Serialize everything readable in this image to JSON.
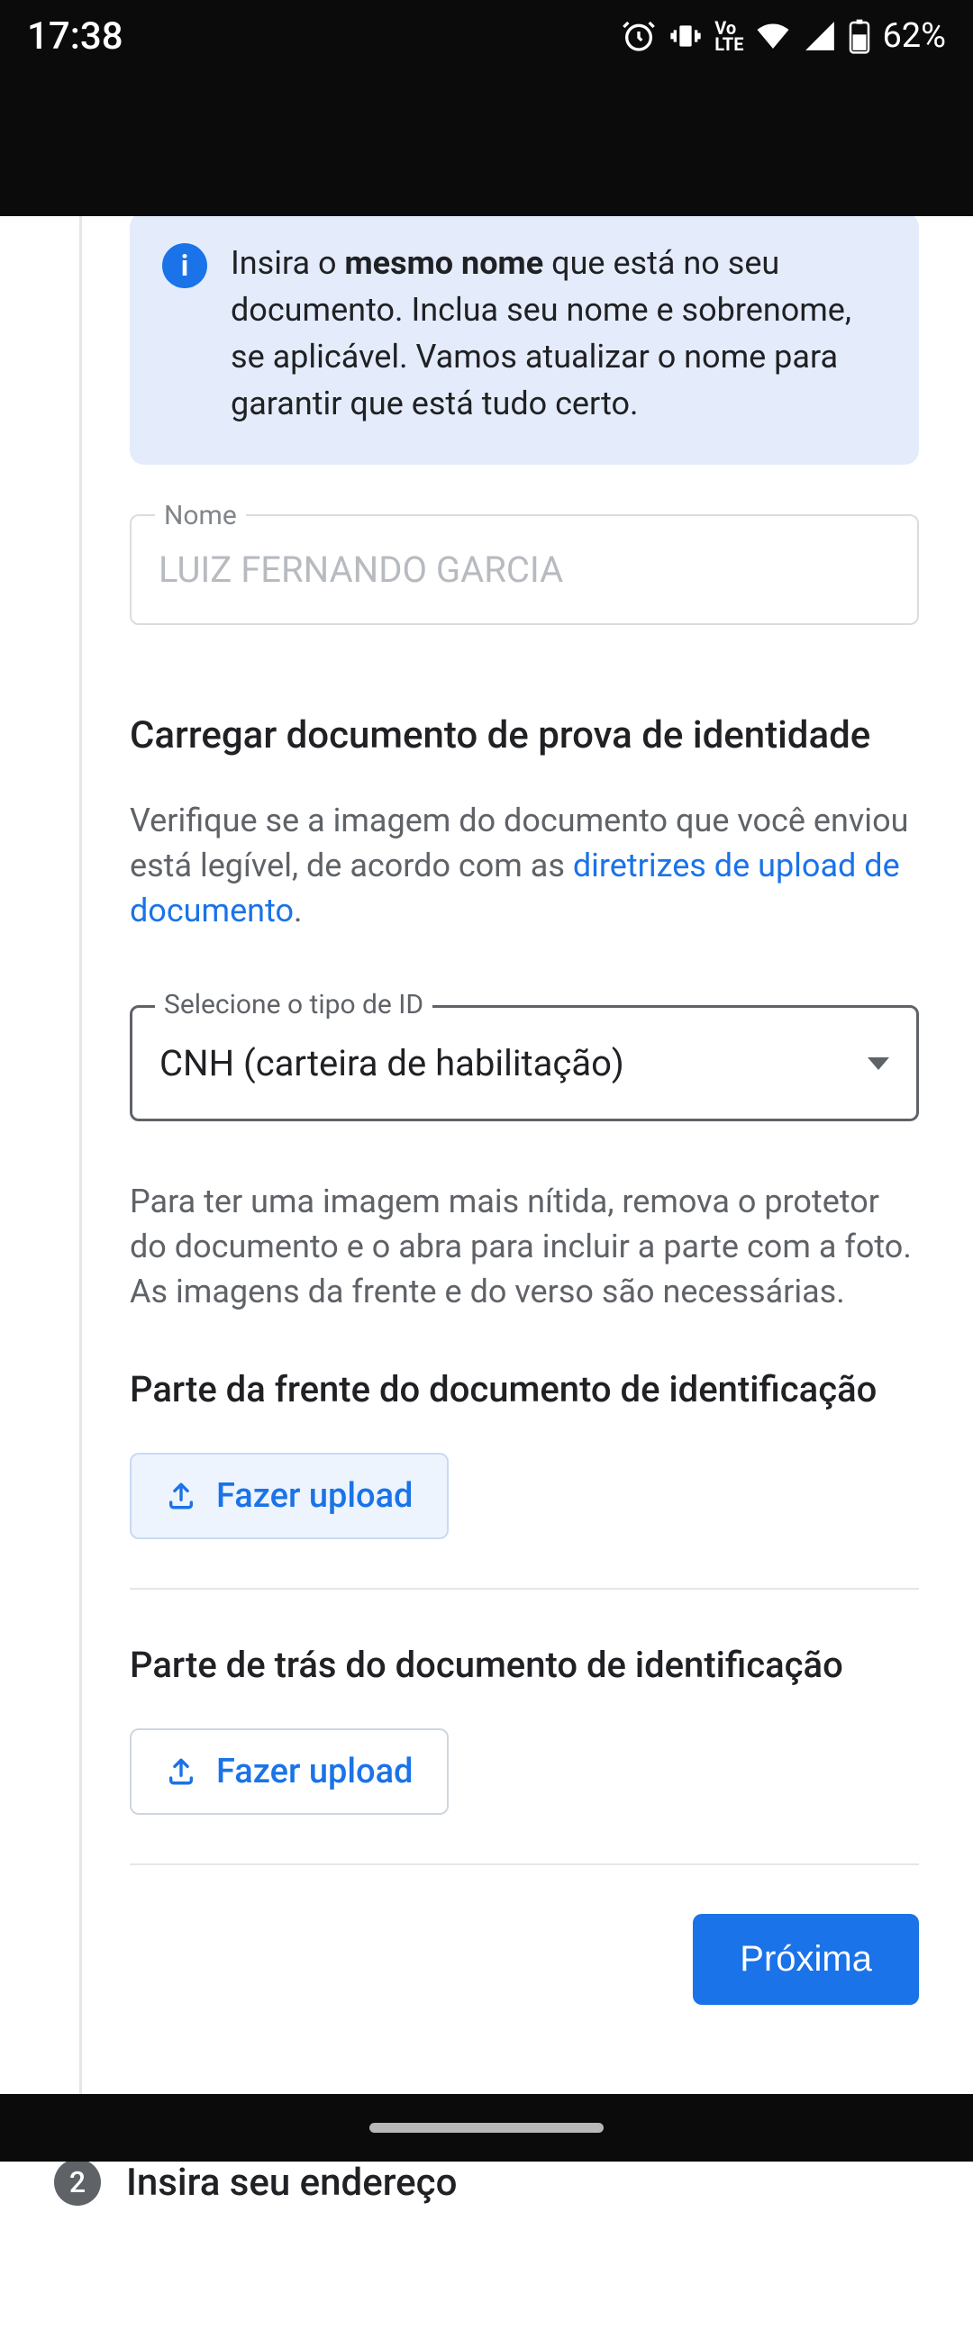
{
  "status": {
    "time": "17:38",
    "battery": "62%"
  },
  "info": {
    "prefix": "Insira o ",
    "bold": "mesmo nome",
    "suffix": " que está no seu documento. Inclua seu nome e sobrenome, se aplicável. Vamos atualizar o nome para garantir que está tudo certo."
  },
  "name_field": {
    "label": "Nome",
    "value": "LUIZ FERNANDO GARCIA"
  },
  "upload_section": {
    "title": "Carregar documento de prova de identidade",
    "subtitle_before": "Verifique se a imagem do documento que você enviou está legível, de acordo com as ",
    "subtitle_link": "diretrizes de upload de documento",
    "subtitle_after": "."
  },
  "id_select": {
    "label": "Selecione o tipo de ID",
    "value": "CNH (carteira de habilitação)"
  },
  "hint": "Para ter uma imagem mais nítida, remova o protetor do documento e o abra para incluir a parte com a foto. As imagens da frente e do verso são necessárias.",
  "front": {
    "heading": "Parte da frente do documento de identificação",
    "button": "Fazer upload"
  },
  "back": {
    "heading": "Parte de trás do documento de identificação",
    "button": "Fazer upload"
  },
  "next_button": "Próxima",
  "step2": {
    "number": "2",
    "label": "Insira seu endereço"
  }
}
